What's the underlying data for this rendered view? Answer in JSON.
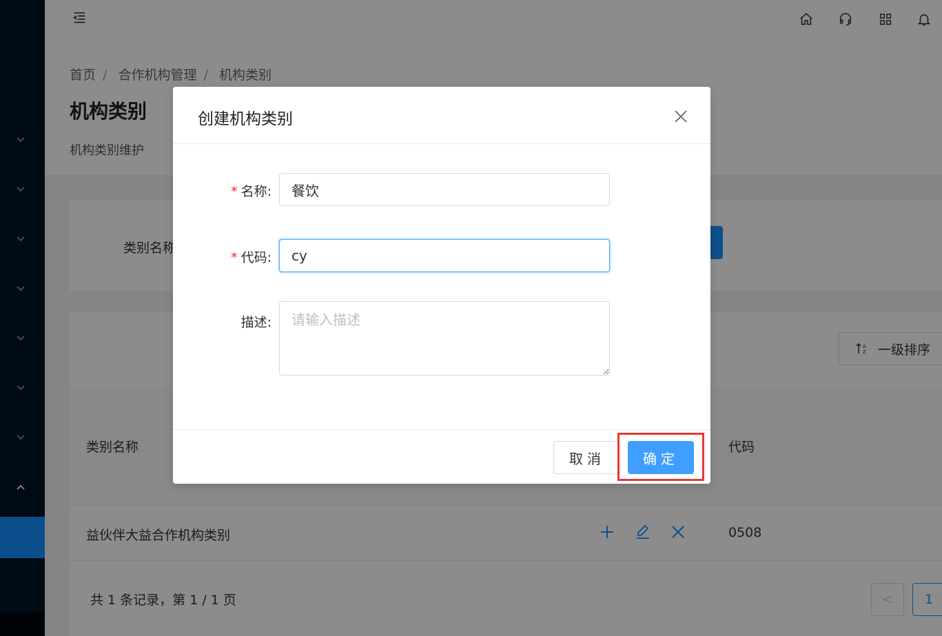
{
  "header": {
    "icons": [
      "home-icon",
      "headset-icon",
      "apps-grid-icon",
      "bell-icon"
    ]
  },
  "breadcrumb": [
    "首页",
    "合作机构管理",
    "机构类别"
  ],
  "breadcrumb_sep": "/",
  "page": {
    "title": "机构类别",
    "description": "机构类别维护"
  },
  "search": {
    "label": "类别名称"
  },
  "table": {
    "sort_label": "一级排序",
    "columns": {
      "name": "类别名称",
      "code": "代码"
    },
    "rows": [
      {
        "name": "益伙伴大益合作机构类别",
        "code": "0508"
      }
    ],
    "pager": {
      "summary": "共 1 条记录，第 1 / 1 页",
      "prev": "<",
      "current": "1"
    }
  },
  "modal": {
    "title": "创建机构类别",
    "fields": {
      "name": {
        "label": "名称:",
        "required": "*",
        "value": "餐饮"
      },
      "code": {
        "label": "代码:",
        "required": "*",
        "value": "cy"
      },
      "description": {
        "label": "描述:",
        "value": "",
        "placeholder": "请输入描述"
      }
    },
    "cancel_label": "取消",
    "ok_label": "确定"
  },
  "colors": {
    "primary": "#409eff",
    "sidebar": "#001529",
    "highlight": "#e53935",
    "required": "#f5222d"
  }
}
